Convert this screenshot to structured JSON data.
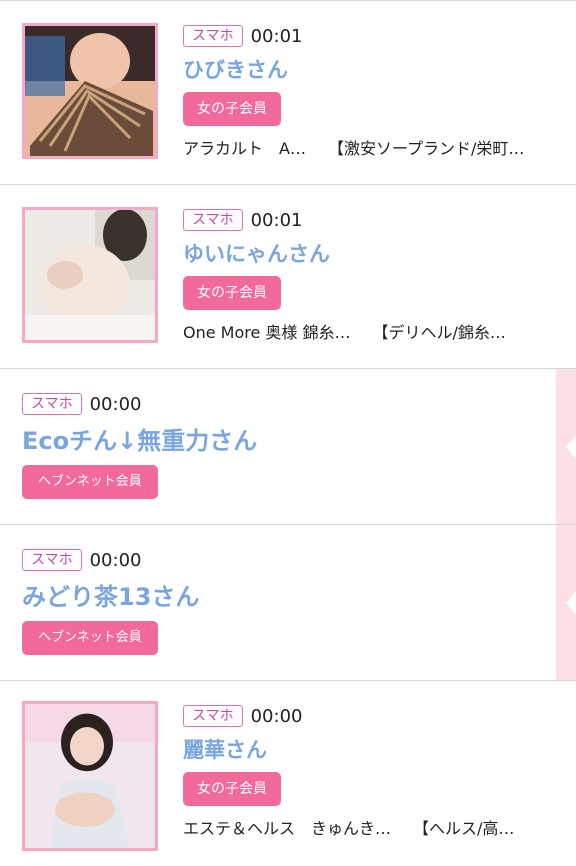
{
  "entries": [
    {
      "device": "スマホ",
      "time": "00:01",
      "name": "ひびきさん",
      "badge": "女の子会員",
      "shop1": "アラカルト　A…",
      "shop2": "【激安ソープランド/栄町…"
    },
    {
      "device": "スマホ",
      "time": "00:01",
      "name": "ゆいにゃんさん",
      "badge": "女の子会員",
      "shop1": "One More 奥様 錦糸…",
      "shop2": "【デリヘル/錦糸…"
    },
    {
      "device": "スマホ",
      "time": "00:00",
      "name": "Ecoチん↓無重力さん",
      "badge": "ヘブンネット会員"
    },
    {
      "device": "スマホ",
      "time": "00:00",
      "name": "みどり茶13さん",
      "badge": "ヘブンネット会員"
    },
    {
      "device": "スマホ",
      "time": "00:00",
      "name": "麗華さん",
      "badge": "女の子会員",
      "shop1": "エステ＆ヘルス　きゅんき…",
      "shop2": "【ヘルス/高…"
    }
  ],
  "colors": {
    "device_border": "#d970c7",
    "name": "#7aa6e0",
    "badge_bg": "#f26a9c",
    "thumb_border": "#f7a8c4",
    "ribbon": "#fde0e5"
  }
}
